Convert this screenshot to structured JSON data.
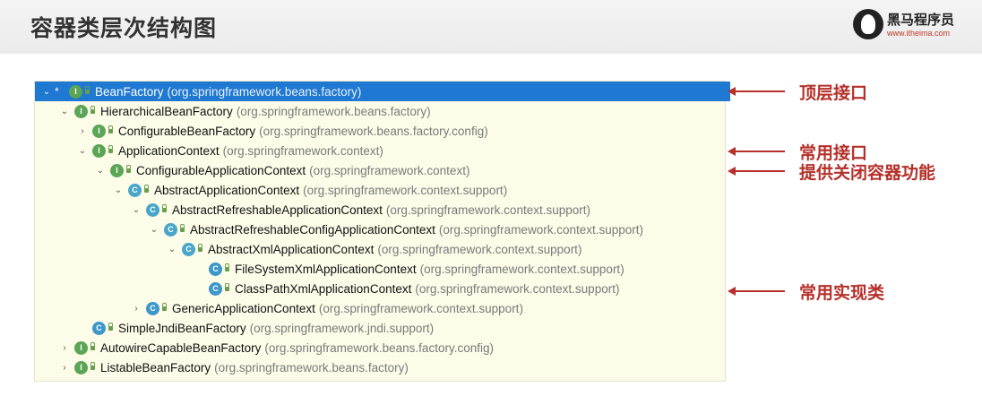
{
  "header": {
    "title": "容器类层次结构图",
    "logo_name": "黑马程序员",
    "logo_url": "www.itheima.com"
  },
  "tree": {
    "rows": [
      {
        "toggle": "⌄",
        "star": "*",
        "icon": "I",
        "icon_type": "interface",
        "name": "BeanFactory",
        "package": "(org.springframework.beans.factory)",
        "selected": true
      },
      {
        "toggle": "⌄",
        "star": "",
        "icon": "I",
        "icon_type": "interface",
        "name": "HierarchicalBeanFactory",
        "package": "(org.springframework.beans.factory)",
        "selected": false
      },
      {
        "toggle": "›",
        "star": "",
        "icon": "I",
        "icon_type": "interface",
        "name": "ConfigurableBeanFactory",
        "package": "(org.springframework.beans.factory.config)",
        "selected": false
      },
      {
        "toggle": "⌄",
        "star": "",
        "icon": "I",
        "icon_type": "interface",
        "name": "ApplicationContext",
        "package": "(org.springframework.context)",
        "selected": false
      },
      {
        "toggle": "⌄",
        "star": "",
        "icon": "I",
        "icon_type": "interface",
        "name": "ConfigurableApplicationContext",
        "package": "(org.springframework.context)",
        "selected": false
      },
      {
        "toggle": "⌄",
        "star": "",
        "icon": "C",
        "icon_type": "abstract",
        "name": "AbstractApplicationContext",
        "package": "(org.springframework.context.support)",
        "selected": false
      },
      {
        "toggle": "⌄",
        "star": "",
        "icon": "C",
        "icon_type": "abstract",
        "name": "AbstractRefreshableApplicationContext",
        "package": "(org.springframework.context.support)",
        "selected": false
      },
      {
        "toggle": "⌄",
        "star": "",
        "icon": "C",
        "icon_type": "abstract",
        "name": "AbstractRefreshableConfigApplicationContext",
        "package": "(org.springframework.context.support)",
        "selected": false
      },
      {
        "toggle": "⌄",
        "star": "",
        "icon": "C",
        "icon_type": "abstract",
        "name": "AbstractXmlApplicationContext",
        "package": "(org.springframework.context.support)",
        "selected": false
      },
      {
        "toggle": "",
        "star": "",
        "icon": "C",
        "icon_type": "class",
        "name": "FileSystemXmlApplicationContext",
        "package": "(org.springframework.context.support)",
        "selected": false
      },
      {
        "toggle": "",
        "star": "",
        "icon": "C",
        "icon_type": "class",
        "name": "ClassPathXmlApplicationContext",
        "package": "(org.springframework.context.support)",
        "selected": false
      },
      {
        "toggle": "›",
        "star": "",
        "icon": "C",
        "icon_type": "class",
        "name": "GenericApplicationContext",
        "package": "(org.springframework.context.support)",
        "selected": false
      },
      {
        "toggle": "",
        "star": "",
        "icon": "C",
        "icon_type": "class",
        "name": "SimpleJndiBeanFactory",
        "package": "(org.springframework.jndi.support)",
        "selected": false
      },
      {
        "toggle": "›",
        "star": "",
        "icon": "I",
        "icon_type": "interface",
        "name": "AutowireCapableBeanFactory",
        "package": "(org.springframework.beans.factory.config)",
        "selected": false
      },
      {
        "toggle": "›",
        "star": "",
        "icon": "I",
        "icon_type": "interface",
        "name": "ListableBeanFactory",
        "package": "(org.springframework.beans.factory)",
        "selected": false
      }
    ]
  },
  "annotations": [
    {
      "text": "顶层接口"
    },
    {
      "text": "常用接口"
    },
    {
      "text": "提供关闭容器功能"
    },
    {
      "text": "常用实现类"
    }
  ],
  "colors": {
    "selection": "#1f78d1",
    "annotation": "#b5302a",
    "tree_background": "#fcfce8"
  }
}
